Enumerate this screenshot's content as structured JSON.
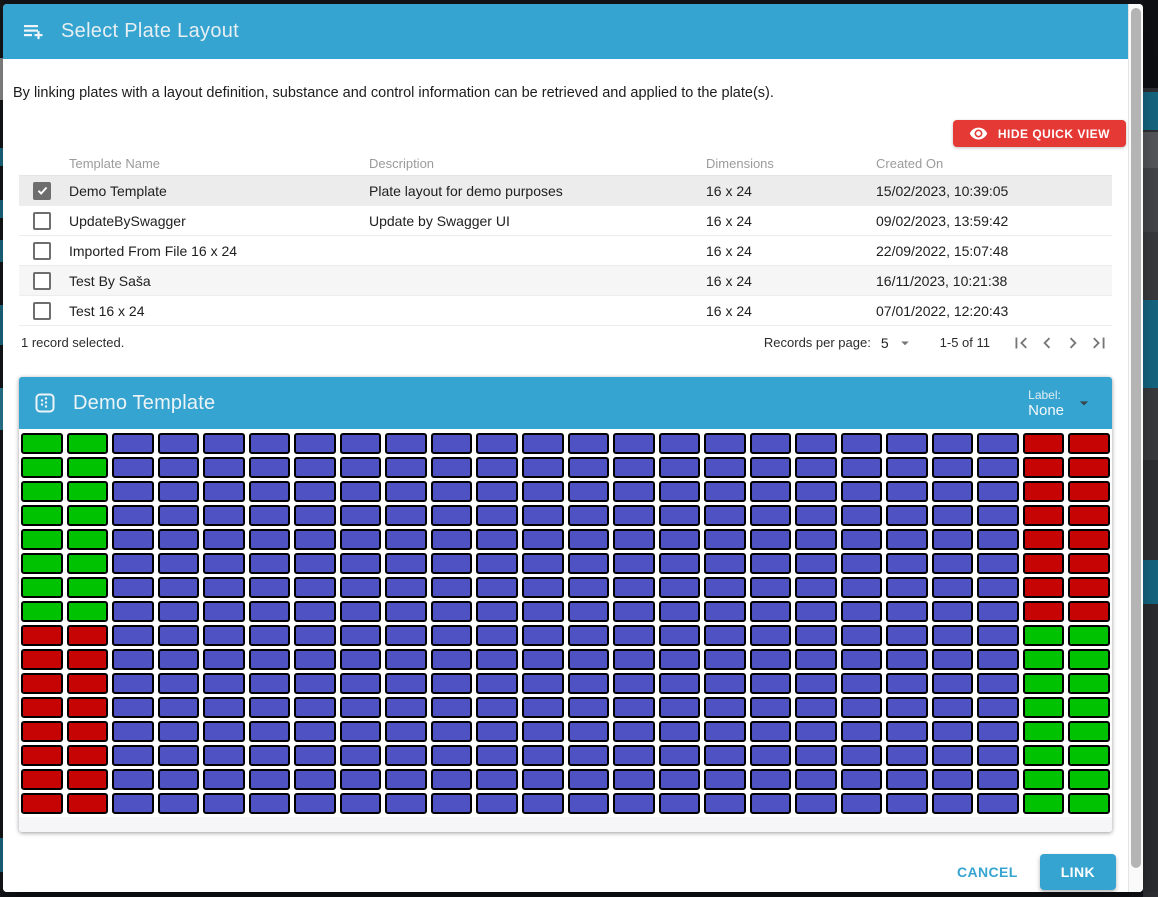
{
  "dialog": {
    "title": "Select Plate Layout",
    "description": "By linking plates with a layout definition, substance and control information can be retrieved and applied to the plate(s).",
    "hide_quick_view_label": "HIDE QUICK VIEW",
    "cancel_label": "CANCEL",
    "link_label": "LINK",
    "accent_color": "#35a4d0",
    "quick_view_button_color": "#e53935"
  },
  "table": {
    "columns": [
      "Template Name",
      "Description",
      "Dimensions",
      "Created On"
    ],
    "rows": [
      {
        "selected": true,
        "highlighted": false,
        "template_name": "Demo Template",
        "description": "Plate layout for demo purposes",
        "dimensions": "16 x 24",
        "created_on": "15/02/2023, 10:39:05"
      },
      {
        "selected": false,
        "highlighted": false,
        "template_name": "UpdateBySwagger",
        "description": "Update by Swagger UI",
        "dimensions": "16 x 24",
        "created_on": "09/02/2023, 13:59:42"
      },
      {
        "selected": false,
        "highlighted": false,
        "template_name": "Imported From File 16 x 24",
        "description": "",
        "dimensions": "16 x 24",
        "created_on": "22/09/2022, 15:07:48"
      },
      {
        "selected": false,
        "highlighted": true,
        "template_name": "Test By Saša",
        "description": "",
        "dimensions": "16 x 24",
        "created_on": "16/11/2023, 10:21:38"
      },
      {
        "selected": false,
        "highlighted": false,
        "template_name": "Test 16 x 24",
        "description": "",
        "dimensions": "16 x 24",
        "created_on": "07/01/2022, 12:20:43"
      }
    ],
    "footer": {
      "selection_text": "1 record selected.",
      "records_per_page_label": "Records per page:",
      "records_per_page_value": "5",
      "range_text": "1-5 of 11"
    }
  },
  "preview": {
    "title": "Demo Template",
    "label_caption": "Label:",
    "label_value": "None",
    "plate": {
      "rows": 16,
      "cols": 24,
      "default_color": "blue",
      "colors": {
        "blue": "#4f52c2",
        "green": "#00c200",
        "red": "#c60404"
      },
      "regions": [
        {
          "rows": "0-7",
          "cols": "0-1",
          "color": "green"
        },
        {
          "rows": "0-7",
          "cols": "22-23",
          "color": "red"
        },
        {
          "rows": "8-15",
          "cols": "0-1",
          "color": "red"
        },
        {
          "rows": "8-15",
          "cols": "22-23",
          "color": "green"
        }
      ]
    }
  }
}
